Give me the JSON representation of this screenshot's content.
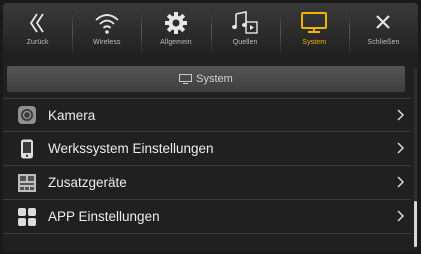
{
  "toolbar": {
    "items": [
      {
        "label": "Zurück",
        "icon": "back-chevron-icon"
      },
      {
        "label": "Wireless",
        "icon": "wifi-icon"
      },
      {
        "label": "Allgemein",
        "icon": "gear-icon"
      },
      {
        "label": "Quellen",
        "icon": "music-source-icon"
      },
      {
        "label": "System",
        "icon": "monitor-icon",
        "active": true
      },
      {
        "label": "Schließen",
        "icon": "close-icon"
      }
    ]
  },
  "section": {
    "title": "System",
    "icon": "monitor-icon"
  },
  "list": {
    "items": [
      {
        "label": "Kamera",
        "icon": "camera-icon"
      },
      {
        "label": "Werkssystem Einstellungen",
        "icon": "phone-icon"
      },
      {
        "label": "Zusatzgeräte",
        "icon": "device-icon"
      },
      {
        "label": "APP Einstellungen",
        "icon": "apps-grid-icon"
      }
    ]
  },
  "colors": {
    "accent": "#f0b400",
    "background": "#202020",
    "text": "#ececec"
  }
}
